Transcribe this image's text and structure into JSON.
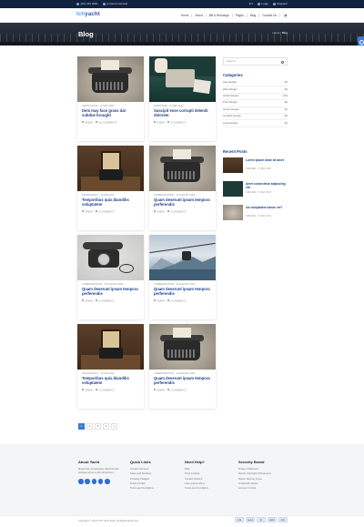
{
  "topbar": {
    "phone": "(00) 444 0001",
    "email": "[email protected]",
    "currency": "$ ▾",
    "login": "Login",
    "register": "Register"
  },
  "header": {
    "logo_a": "Ich",
    "logo_b": "yacht",
    "nav": [
      "Home",
      "About",
      "Bill & Recharge",
      "Pages",
      "Blog",
      "Contact Us"
    ]
  },
  "hero": {
    "title": "Blog",
    "crumb_home": "Home",
    "crumb_sep": " / ",
    "crumb_current": "Blog"
  },
  "posts": [
    {
      "meta": "LEWIS GOYAL · 07 DEC 2023",
      "title": "Dem may face grass dat subdue brought",
      "by": "ADMIN",
      "comments": "ALL COMMENTS"
    },
    {
      "meta": "FURNITURE · 11 DEC 2023",
      "title": "Suscipit esse corrupti deleniti dolorem",
      "by": "ADMIN",
      "comments": "0 COMMENTS"
    },
    {
      "meta": "TECHNOLOGY · 10 JAN 2023",
      "title": "Temporibus quia blanditis voluptatem",
      "by": "ADMIN",
      "comments": "0 COMMENTS"
    },
    {
      "meta": "COMMUNICATION · 10 AUGUST 2023",
      "title": "Quam deserunt ipsam tempora perferendis",
      "by": "ADMIN",
      "comments": "0 COMMENTS"
    },
    {
      "meta": "COMMUNICATION · 10 AUGUST 2023",
      "title": "Quam deserunt ipsam tempora perferendis",
      "by": "ADMIN",
      "comments": "0 COMMENTS"
    },
    {
      "meta": "COMMUNICATION · 10 AUGUST 2023",
      "title": "Quam deserunt ipsam tempora perferendis",
      "by": "ADMIN",
      "comments": "0 COMMENTS"
    },
    {
      "meta": "TECHNOLOGY · 10 JAN 2023",
      "title": "Temporibus quia blanditis voluptatem",
      "by": "ADMIN",
      "comments": "0 COMMENTS"
    },
    {
      "meta": "COMMUNICATION · 10 AUGUST 2023",
      "title": "Quam deserunt ipsam tempora perferendis",
      "by": "ADMIN",
      "comments": "0 COMMENTS"
    }
  ],
  "sidebar": {
    "search_placeholder": "Search...",
    "categories_title": "Categories",
    "categories": [
      {
        "name": "App Design",
        "count": "(9)"
      },
      {
        "name": "Web Design",
        "count": "(9)"
      },
      {
        "name": "UI/UX Design",
        "count": "(13)"
      },
      {
        "name": "Print Design",
        "count": "(9)"
      },
      {
        "name": "Game Design",
        "count": "(9)"
      },
      {
        "name": "Graphic Design",
        "count": "(9)"
      },
      {
        "name": "Logo Design",
        "count": "(9)"
      }
    ],
    "recent_title": "Recent Posts",
    "recent": [
      {
        "title": "Lorem ipsum dolor sit amet",
        "date": "CREATED · 07 DEC 2023"
      },
      {
        "title": "Amet consectetur adipiscing elit.",
        "date": "CREATED · 07 DEC 2023"
      },
      {
        "title": "Ius voluptatem harum vel?",
        "date": "CREATED · 07 DEC 2023"
      }
    ]
  },
  "pagination": [
    "1",
    "2",
    "3",
    "4",
    "»"
  ],
  "footer": {
    "about_title": "About Yacht",
    "about_text": "Maecenas consectetuer dapibus velit tristique elit an ut dui elementum.",
    "quick_title": "Quick Links",
    "quick": [
      "Contact Services",
      "Sales and Services",
      "Privately Pledged",
      "Privacy Policy",
      "Terms and Conditions"
    ],
    "help_title": "Need Help?",
    "help": [
      "FAQ",
      "Price Looking",
      "Contact Options",
      "Care and Funding",
      "Terms and Conditions"
    ],
    "security_title": "Security Brand",
    "security": [
      "Privacy Statement",
      "Report Copyright Infringement",
      "Report Security Issue",
      "Trademark Notice",
      "Account Control"
    ],
    "copyright": "Copyright © 2023 ITIS Yacht 2023. All Rights Reserved.",
    "payments": [
      "VISA",
      "PayPal",
      "MC",
      "AMEX",
      "DISC"
    ]
  }
}
